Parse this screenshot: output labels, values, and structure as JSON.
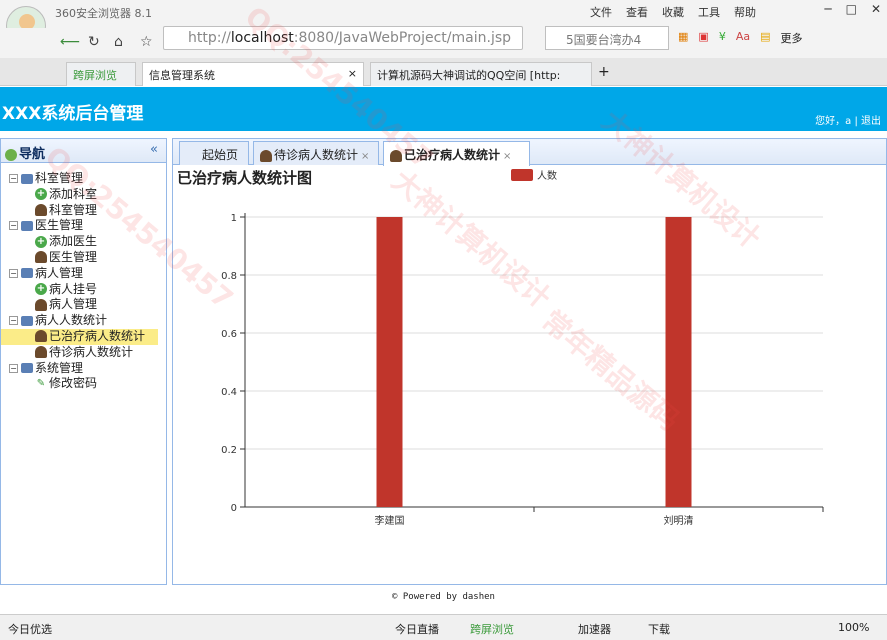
{
  "browser": {
    "app_title": "360安全浏览器 8.1",
    "menu": [
      "文件",
      "查看",
      "收藏",
      "工具",
      "帮助"
    ],
    "url_prefix": "http://",
    "url_host": "localhost",
    "url_rest": ":8080/JavaWebProject/main.jsp",
    "search_text": "5国要台湾办4",
    "ext_more": "更多",
    "tabs": [
      {
        "label": "跨屏浏览"
      },
      {
        "label": "信息管理系统"
      },
      {
        "label": "计算机源码大神调试的QQ空间 [http:"
      }
    ],
    "status": {
      "left": "今日优选",
      "live": "今日直播",
      "cross": "跨屏浏览",
      "accel": "加速器",
      "download": "下载",
      "zoom": "100%"
    }
  },
  "banner": {
    "title": "XXX系统后台管理",
    "user_text": "您好，a  |  退出"
  },
  "nav": {
    "title": "导航",
    "collapse": "«",
    "tree": [
      {
        "label": "科室管理",
        "children": [
          "添加科室",
          "科室管理"
        ]
      },
      {
        "label": "医生管理",
        "children": [
          "添加医生",
          "医生管理"
        ]
      },
      {
        "label": "病人管理",
        "children": [
          "病人挂号",
          "病人管理"
        ]
      },
      {
        "label": "病人人数统计",
        "children": [
          "已治疗病人数统计",
          "待诊病人数统计"
        ]
      },
      {
        "label": "系统管理",
        "children": [
          "修改密码"
        ]
      }
    ],
    "selected": "已治疗病人数统计"
  },
  "page_tabs": [
    {
      "label": "起始页",
      "closable": false
    },
    {
      "label": "待诊病人数统计",
      "closable": true
    },
    {
      "label": "已治疗病人数统计",
      "closable": true
    }
  ],
  "chart_data": {
    "type": "bar",
    "title": "已治疗病人数统计图",
    "categories": [
      "李建国",
      "刘明清"
    ],
    "series": [
      {
        "name": "人数",
        "values": [
          1,
          1
        ],
        "color": "#c0352b"
      }
    ],
    "ylim": [
      0,
      1
    ],
    "yticks": [
      "0",
      "0.2",
      "0.4",
      "0.6",
      "0.8",
      "1"
    ],
    "grid": true,
    "legend": "top-center"
  },
  "footer": "© Powered by dashen",
  "watermarks": [
    "QQ:254540457",
    "大神计算机设计",
    "常年精品源码",
    "QQ:254540457",
    "大神计算机设计"
  ]
}
